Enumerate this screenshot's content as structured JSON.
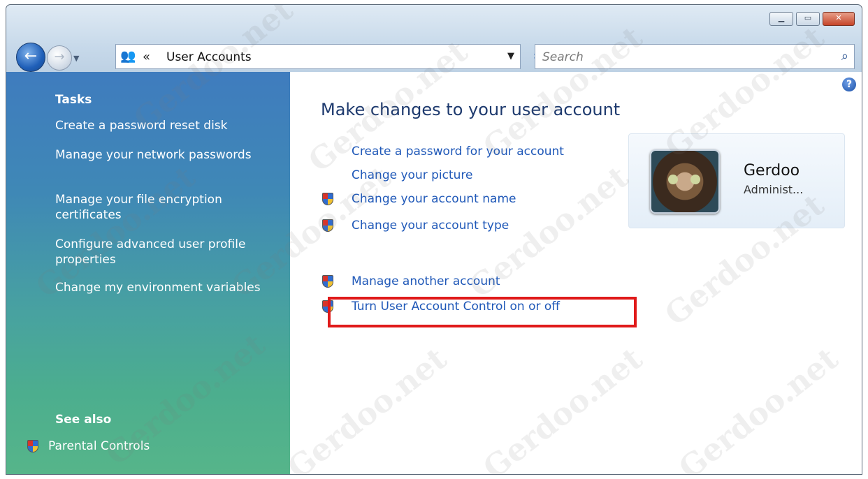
{
  "window": {
    "title_buttons": [
      "minimize",
      "maximize",
      "close"
    ]
  },
  "nav": {
    "address_path": "User Accounts",
    "search_placeholder": "Search"
  },
  "sidebar": {
    "tasks_heading": "Tasks",
    "tasks": [
      "Create a password reset disk",
      "Manage your network passwords",
      "Manage your file encryption certificates",
      "Configure advanced user profile properties",
      "Change my environment variables"
    ],
    "see_also_heading": "See also",
    "see_also": [
      "Parental Controls"
    ]
  },
  "main": {
    "title": "Make changes to your user account",
    "links": [
      "Create a password for your account",
      "Change your picture",
      "Change your account name",
      "Change your account type"
    ],
    "other_links": [
      "Manage another account",
      "Turn User Account Control on or off"
    ]
  },
  "user": {
    "name": "Gerdoo",
    "role": "Administ..."
  },
  "watermark": "Gerdoo.net",
  "colors": {
    "link": "#1f58b8",
    "highlight_box": "#e01a1a",
    "sidebar_top": "#3f7cbe",
    "sidebar_bottom": "#56b58a"
  }
}
